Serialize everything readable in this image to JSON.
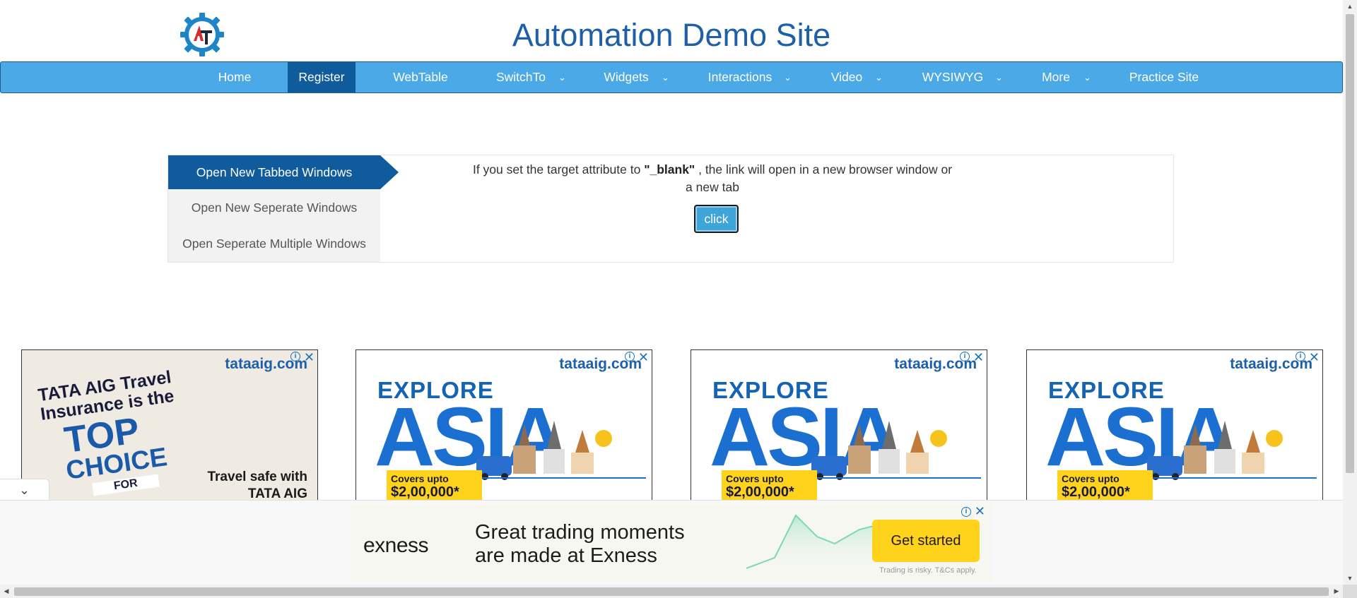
{
  "header": {
    "title": "Automation Demo Site",
    "logo_text": "AT"
  },
  "nav": {
    "items": [
      {
        "label": "Home",
        "has_dropdown": false,
        "active": false
      },
      {
        "label": "Register",
        "has_dropdown": false,
        "active": true
      },
      {
        "label": "WebTable",
        "has_dropdown": false,
        "active": false
      },
      {
        "label": "SwitchTo",
        "has_dropdown": true,
        "active": false
      },
      {
        "label": "Widgets",
        "has_dropdown": true,
        "active": false
      },
      {
        "label": "Interactions",
        "has_dropdown": true,
        "active": false
      },
      {
        "label": "Video",
        "has_dropdown": true,
        "active": false
      },
      {
        "label": "WYSIWYG",
        "has_dropdown": true,
        "active": false
      },
      {
        "label": "More",
        "has_dropdown": true,
        "active": false
      },
      {
        "label": "Practice Site",
        "has_dropdown": false,
        "active": false
      }
    ],
    "chevron_glyph": "⌄"
  },
  "windows": {
    "tabs": [
      {
        "label": "Open New Tabbed Windows",
        "active": true
      },
      {
        "label": "Open New Seperate Windows",
        "active": false
      },
      {
        "label": "Open Seperate Multiple Windows",
        "active": false
      }
    ],
    "description_pre": "If you set the target attribute to ",
    "description_bold": "\"_blank\"",
    "description_post": " , the link will open in a new browser window or a new tab",
    "button_label": "click"
  },
  "ads": {
    "close_glyph": "✕",
    "info_glyph": "i",
    "card1": {
      "brand": "tataaig.com",
      "line1": "TATA AIG Travel Insurance is the",
      "top": "TOP",
      "choice": "CHOICE",
      "for": "FOR",
      "safe": "Travel safe with TATA AIG"
    },
    "card_asia": {
      "brand": "tataaig.com",
      "explore": "EXPLORE",
      "asia": "ASIA",
      "covers": "Covers upto",
      "amount": "$2,00,000*"
    },
    "exness": {
      "logo": "exness",
      "line1": "Great trading moments",
      "line2": "are made at Exness",
      "cta": "Get started",
      "risk": "Trading is risky. T&Cs apply."
    },
    "sticky_toggle_glyph": "⌄"
  },
  "colors": {
    "nav_bg": "#4aa9e6",
    "nav_active": "#0f5b9c",
    "title": "#1d5fa8",
    "cta_yellow": "#ffd21c"
  }
}
